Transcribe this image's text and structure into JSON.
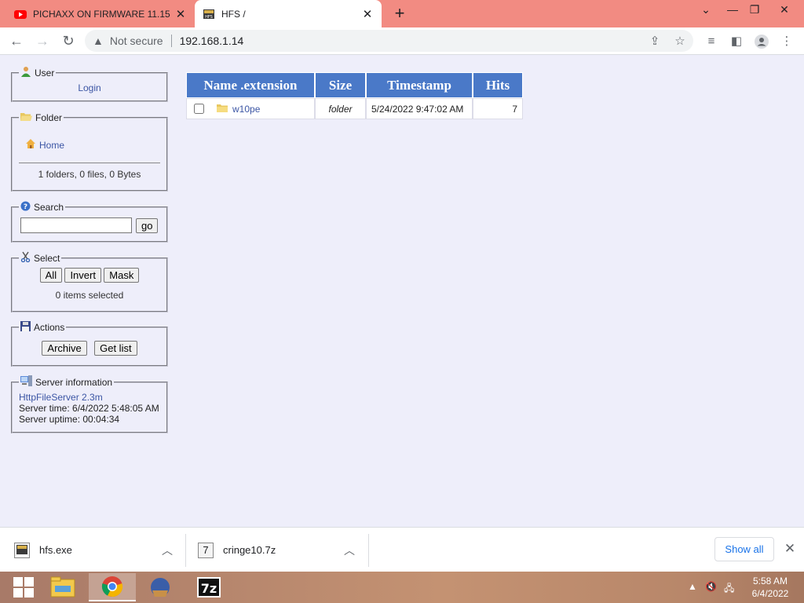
{
  "browser": {
    "tabs": [
      {
        "title": "PICHAXX ON FIRMWARE 11.15 -",
        "icon": "youtube-icon",
        "active": false
      },
      {
        "title": "HFS /",
        "icon": "hfs-icon",
        "active": true
      }
    ],
    "security_label": "Not secure",
    "url": "192.168.1.14"
  },
  "sidebar": {
    "user": {
      "title": "User",
      "login": "Login"
    },
    "folder": {
      "title": "Folder",
      "home": "Home",
      "summary": "1 folders, 0 files, 0 Bytes"
    },
    "search": {
      "title": "Search",
      "go": "go",
      "value": ""
    },
    "select": {
      "title": "Select",
      "all": "All",
      "invert": "Invert",
      "mask": "Mask",
      "status": "0 items selected"
    },
    "actions": {
      "title": "Actions",
      "archive": "Archive",
      "getlist": "Get list"
    },
    "server": {
      "title": "Server information",
      "version": "HttpFileServer 2.3m",
      "time": "Server time: 6/4/2022 5:48:05 AM",
      "uptime": "Server uptime: 00:04:34"
    }
  },
  "files": {
    "headers": [
      "Name .extension",
      "Size",
      "Timestamp",
      "Hits"
    ],
    "rows": [
      {
        "name": "w10pe",
        "size": "folder",
        "timestamp": "5/24/2022 9:47:02 AM",
        "hits": "7"
      }
    ]
  },
  "downloads": {
    "items": [
      {
        "name": "hfs.exe",
        "icon": "hfs-exe-icon"
      },
      {
        "name": "cringe10.7z",
        "icon": "archive-file-icon"
      }
    ],
    "show_all": "Show all"
  },
  "taskbar": {
    "time": "5:58 AM",
    "date": "6/4/2022",
    "apps": [
      "start-button",
      "file-explorer-icon",
      "chrome-icon",
      "hfs-app-icon",
      "7zip-icon"
    ]
  }
}
